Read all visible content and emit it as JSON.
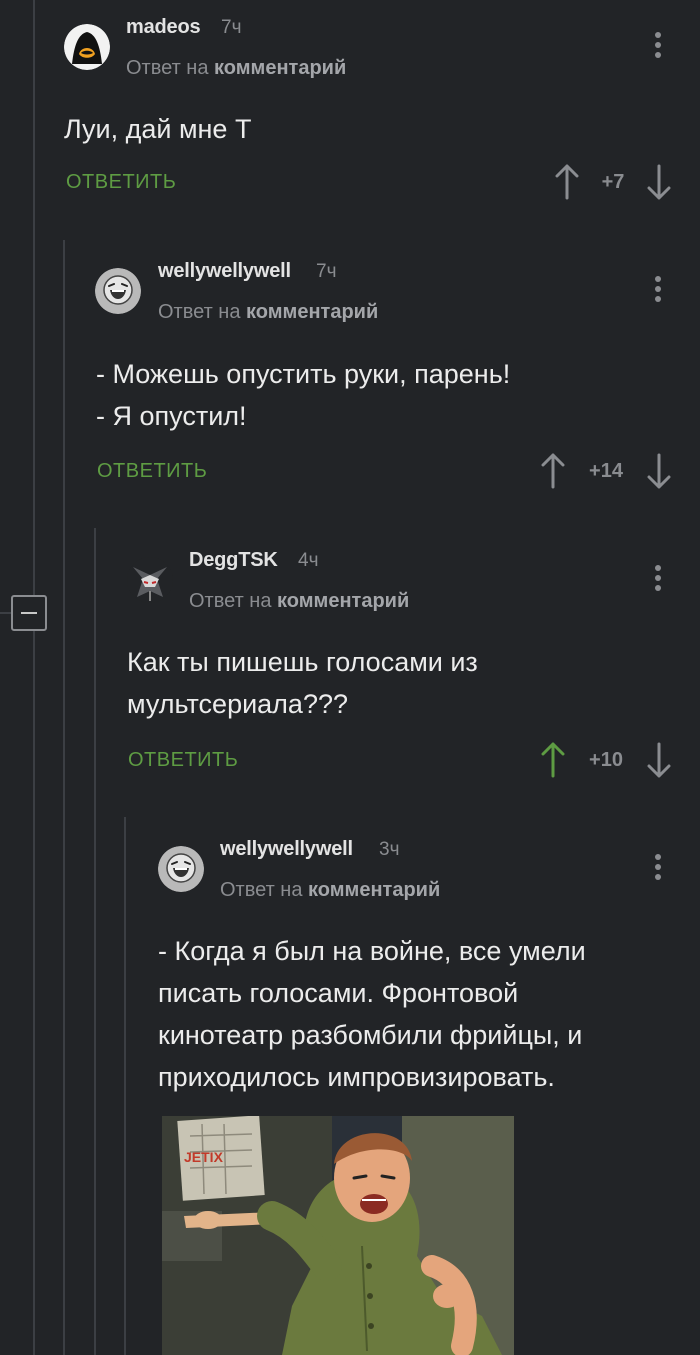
{
  "comments": [
    {
      "username": "madeos",
      "time": "7ч",
      "reply_prefix": "Ответ на",
      "reply_target": "комментарий",
      "text": "Луи, дай мне Т",
      "reply_label": "ОТВЕТИТЬ",
      "rating": "+7",
      "avatar_icon": "hooded-figure-avatar"
    },
    {
      "username": "wellywellywell",
      "time": "7ч",
      "reply_prefix": "Ответ на",
      "reply_target": "комментарий",
      "text": "- Можешь опустить руки, парень!\n- Я опустил!",
      "reply_label": "ОТВЕТИТЬ",
      "rating": "+14",
      "avatar_icon": "laughing-face-avatar"
    },
    {
      "username": "DeggTSK",
      "time": "4ч",
      "reply_prefix": "Ответ на",
      "reply_target": "комментарий",
      "text": "Как ты пишешь голосами из\nмультсериала???",
      "reply_label": "ОТВЕТИТЬ",
      "rating": "+10",
      "upvoted": true,
      "avatar_icon": "armored-helmet-avatar"
    },
    {
      "username": "wellywellywell",
      "time": "3ч",
      "reply_prefix": "Ответ на",
      "reply_target": "комментарий",
      "text": "- Когда я был на войне, все умели\nписать голосами. Фронтовой\nкинотеатр разбомбили фрийцы, и\nприходилось импровизировать.",
      "avatar_icon": "laughing-face-avatar",
      "image_watermark": "JETIX"
    }
  ],
  "colors": {
    "background": "#222427",
    "reply_green": "#5e9c43",
    "upvoted_green": "#5e9c43",
    "muted": "#8a8c90",
    "thread_line": "#3c3f44"
  }
}
